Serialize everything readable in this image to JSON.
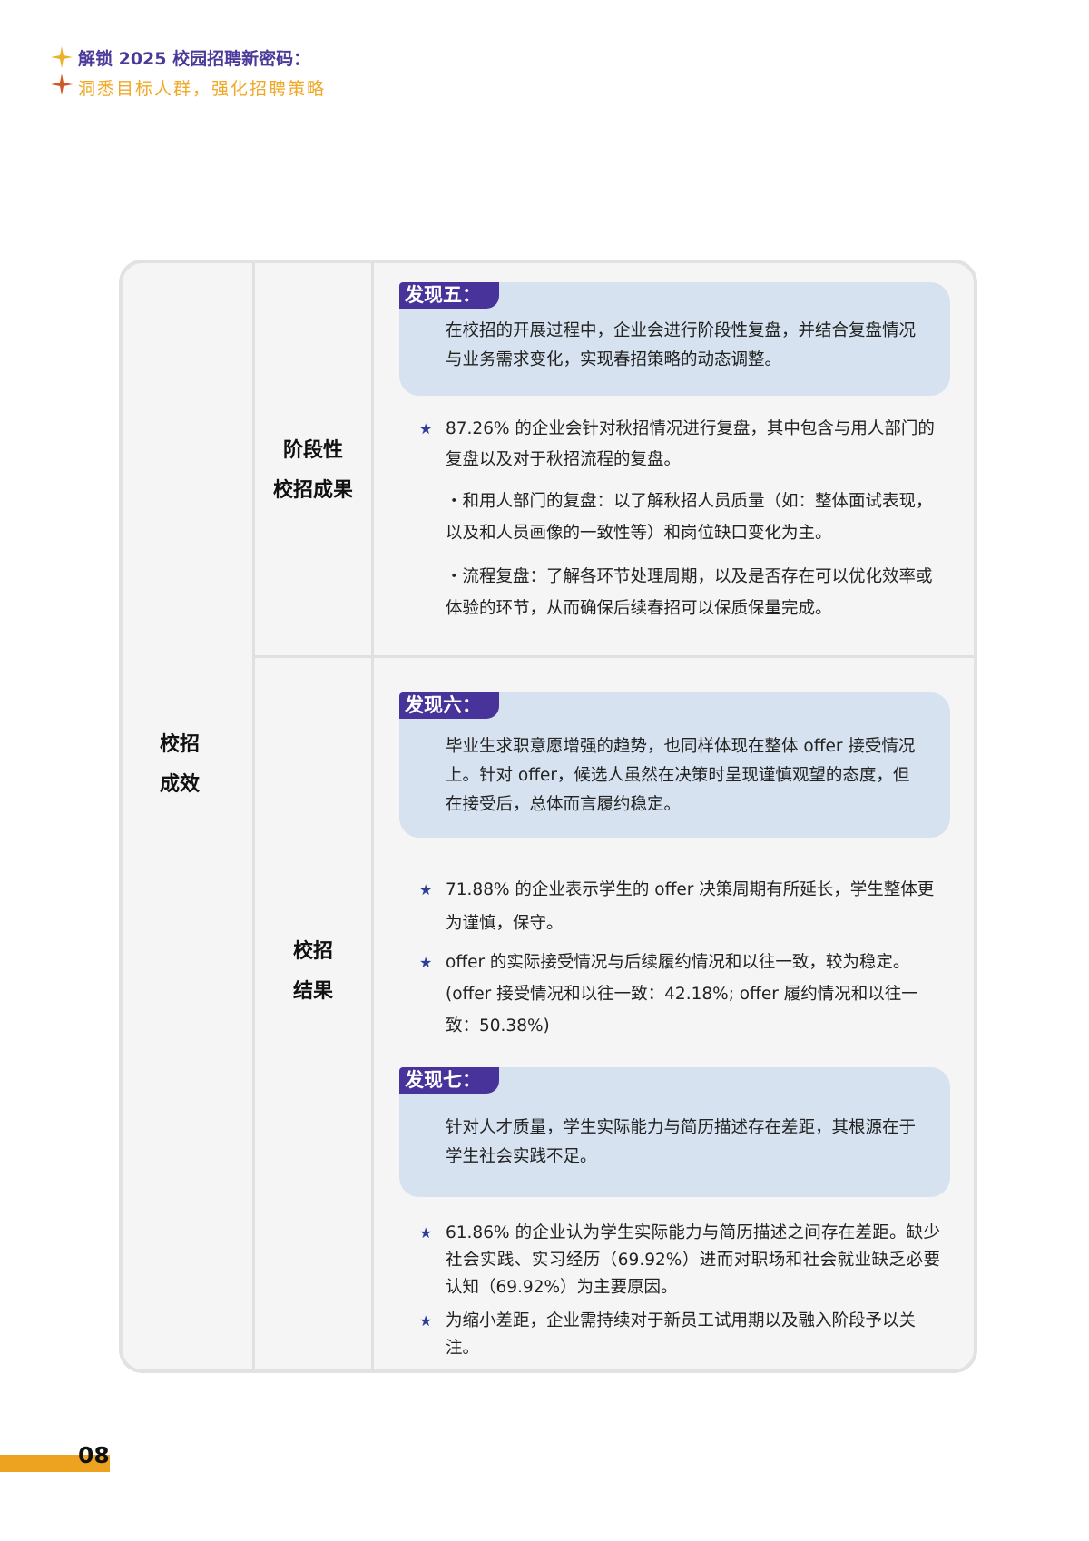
{
  "header": {
    "line1": "解锁 2025 校园招聘新密码：",
    "line2": "洞悉目标人群，强化招聘策略",
    "colors": {
      "purple": "#4b3a9a",
      "orange": "#f0a826",
      "star1": "#eab12c",
      "star2": "#d0592a"
    }
  },
  "table": {
    "col1_label": [
      "校招",
      "成效"
    ],
    "section1": {
      "label": [
        "阶段性",
        "校招成果"
      ],
      "finding": {
        "tag": "发现五：",
        "text": "在校招的开展过程中，企业会进行阶段性复盘，并结合复盘情况与业务需求变化，实现春招策略的动态调整。"
      },
      "bullets": [
        "87.26% 的企业会针对秋招情况进行复盘，其中包含与用人部门的复盘以及对于秋招流程的复盘。"
      ],
      "subs": [
        "・和用人部门的复盘：以了解秋招人员质量（如：整体面试表现，以及和人员画像的一致性等）和岗位缺口变化为主。",
        "・流程复盘：了解各环节处理周期，以及是否存在可以优化效率或体验的环节，从而确保后续春招可以保质保量完成。"
      ]
    },
    "section2": {
      "label": [
        "校招",
        "结果"
      ],
      "finding6": {
        "tag": "发现六：",
        "text": "毕业生求职意愿增强的趋势，也同样体现在整体 offer 接受情况上。针对 offer，候选人虽然在决策时呈现谨慎观望的态度，但在接受后，总体而言履约稳定。"
      },
      "bullets6": [
        "71.88% 的企业表示学生的 offer 决策周期有所延长，学生整体更为谨慎，保守。",
        "offer 的实际接受情况与后续履约情况和以往一致，较为稳定。(offer 接受情况和以往一致：42.18%; offer 履约情况和以往一致：50.38%)"
      ],
      "finding7": {
        "tag": "发现七：",
        "text": "针对人才质量，学生实际能力与简历描述存在差距，其根源在于学生社会实践不足。"
      },
      "bullets7": [
        "61.86% 的企业认为学生实际能力与简历描述之间存在差距。缺少社会实践、实习经历（69.92%）进而对职场和社会就业缺乏必要认知（69.92%）为主要原因。",
        "为缩小差距，企业需持续对于新员工试用期以及融入阶段予以关注。"
      ]
    }
  },
  "page_number": "08",
  "star_icon": "★"
}
